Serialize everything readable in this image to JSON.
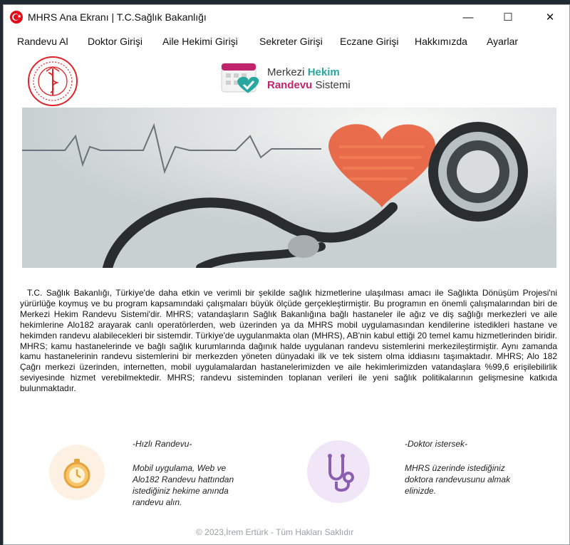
{
  "window": {
    "title": "MHRS Ana Ekranı | T.C.Sağlık Bakanlığı",
    "controls": {
      "minimize": "—",
      "maximize": "☐",
      "close": "✕"
    }
  },
  "menu": [
    "Randevu Al",
    "Doktor Girişi",
    "Aile Hekimi Girişi",
    "Sekreter Girişi",
    "Eczane Girişi",
    "Hakkımızda",
    "Ayarlar"
  ],
  "logo": {
    "line1_plain": "Merkezi ",
    "line1_accent": "Hekim",
    "line2_accent": "Randevu",
    "line2_plain": " Sistemi"
  },
  "description": "T.C. Sağlık Bakanlığı, Türkiye'de daha etkin ve verimli bir şekilde sağlık hizmetlerine ulaşılması amacı ile Sağlıkta Dönüşüm Projesi'ni yürürlüğe koymuş ve bu program kapsamındaki çalışmaları büyük ölçüde gerçekleştirmiştir. Bu programın en önemli çalışmalarından biri de Merkezi Hekim Randevu Sistemi'dir. MHRS; vatandaşların Sağlık Bakanlığına bağlı hastaneler ile ağız ve diş sağlığı merkezleri ve aile hekimlerine Alo182 arayarak canlı operatörlerden, web üzerinden ya da MHRS mobil uygulamasından kendilerine istedikleri hastane ve hekimden randevu alabilecekleri bir sistemdir. Türkiye'de uygulanmakta olan (MHRS), AB'nin kabul ettiği 20 temel kamu hizmetlerinden biridir. MHRS; kamu hastanelerinde ve bağlı sağlık kurumlarında dağınık halde uygulanan randevu sistemlerini merkezileştirmiştir. Aynı zamanda kamu hastanelerinin randevu sistemlerini bir merkezden yöneten dünyadaki ilk ve tek sistem olma iddiasını taşımaktadır. MHRS; Alo 182 Çağrı merkezi üzerinden, internetten, mobil uygulamalardan hastanelerimizden ve aile hekimlerimizden vatandaşlara %99,6 erişilebilirlik seviyesinde hizmet verebilmektedir. MHRS; randevu sisteminden toplanan verileri ile yeni sağlık politikalarının gelişmesine katkıda bulunmaktadır.",
  "features": [
    {
      "title": "-Hızlı Randevu-",
      "text": "Mobil uygulama, Web ve Alo182 Randevu hattından istediğiniz hekime anında randevu alın.",
      "icon": "stopwatch-icon"
    },
    {
      "title": "-Doktor istersek-",
      "text": "MHRS üzerinde istediğiniz doktora randevusunu almak elinizde.",
      "icon": "stethoscope-icon"
    }
  ],
  "footer": "© 2023,İrem Ertürk - Tüm Hakları Saklıdır",
  "colors": {
    "flag_red": "#e30a17",
    "logo_teal": "#26a7a0",
    "logo_magenta": "#c0246c",
    "feature1_bg": "#fdf1e4",
    "feature2_bg": "#f1e6f8"
  }
}
